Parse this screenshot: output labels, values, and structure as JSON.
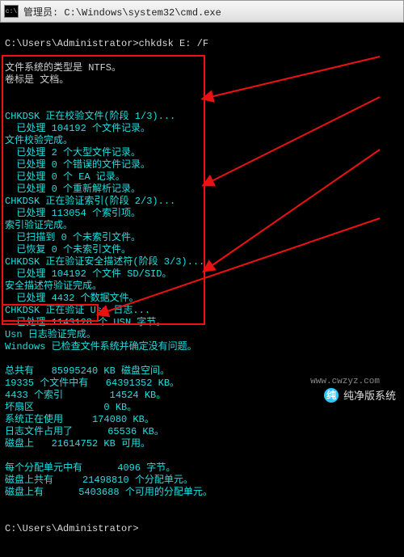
{
  "window": {
    "title": "管理员: C:\\Windows\\system32\\cmd.exe",
    "icon_label": "c:\\"
  },
  "prompt1": "C:\\Users\\Administrator>chkdsk E: /F",
  "lines_pre": [
    "文件系统的类型是 NTFS。",
    "卷标是 文档。",
    ""
  ],
  "lines_box": [
    "CHKDSK 正在校验文件(阶段 1/3)...",
    "  已处理 104192 个文件记录。",
    "文件校验完成。",
    "  已处理 2 个大型文件记录。",
    "  已处理 0 个错误的文件记录。",
    "  已处理 0 个 EA 记录。",
    "  已处理 0 个重新解析记录。",
    "CHKDSK 正在验证索引(阶段 2/3)...",
    "  已处理 113054 个索引项。",
    "索引验证完成。",
    "  已扫描到 0 个未索引文件。",
    "  已恢复 0 个未索引文件。",
    "CHKDSK 正在验证安全描述符(阶段 3/3)...",
    "  已处理 104192 个文件 SD/SID。",
    "安全描述符验证完成。",
    "  已处理 4432 个数据文件。",
    "CHKDSK 正在验证 Usn 日志...",
    "  已处理 1143128 个 USN 字节。",
    "Usn 日志验证完成。",
    "Windows 已检查文件系统并确定没有问题。",
    "",
    "总共有   85995240 KB 磁盘空间。",
    "19335 个文件中有   64391352 KB。",
    "4433 个索引        14524 KB。",
    "坏扇区            0 KB。",
    "系统正在使用     174080 KB。",
    "日志文件占用了      65536 KB。",
    "磁盘上   21614752 KB 可用。",
    "",
    "每个分配单元中有      4096 字节。",
    "磁盘上共有     21498810 个分配单元。",
    "磁盘上有      5403688 个可用的分配单元。"
  ],
  "prompt2": "C:\\Users\\Administrator>",
  "watermark": {
    "brand": "纯净版系统",
    "url": "www.cwzyz.com"
  }
}
